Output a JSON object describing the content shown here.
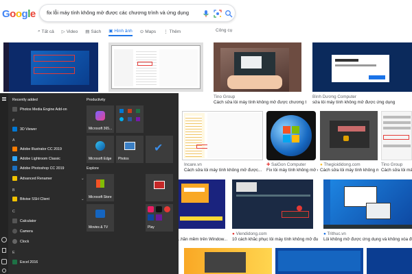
{
  "logo": "Google",
  "search": {
    "query": "fix lỗi máy tính không mở được các chương trình và ứng dụng"
  },
  "tabs": [
    {
      "label": "Tất cả",
      "icon": "search-icon",
      "active": false
    },
    {
      "label": "Video",
      "icon": "play-icon",
      "active": false
    },
    {
      "label": "Sách",
      "icon": "book-icon",
      "active": false
    },
    {
      "label": "Hình ảnh",
      "icon": "image-icon",
      "active": true
    },
    {
      "label": "Maps",
      "icon": "map-pin-icon",
      "active": false
    },
    {
      "label": "Thêm",
      "icon": "more-vert-icon",
      "active": false
    }
  ],
  "tools": "Công cụ",
  "results": [
    {
      "source": "",
      "title": ""
    },
    {
      "source": "",
      "title": ""
    },
    {
      "source": "Tino Group",
      "title": "Cách sửa lỗi máy tính không mở được chương tri..."
    },
    {
      "source": "Bình Dương Computer",
      "title": "sửa lỗi máy tính không mở được ứng dụng"
    },
    {
      "source": "Incare.vn",
      "title": "Cách sửa lỗi máy tính không mở được..."
    },
    {
      "source": "SaiGon Computer",
      "title": "Fix lỗi máy tính không mở được ứng dụng..."
    },
    {
      "source": "Thegioididong.com",
      "title": "Cách sửa lỗi máy tính không mở..."
    },
    {
      "source": "Tino Group",
      "title": "Cách sửa lỗi máy tí..."
    },
    {
      "source": "",
      "title": "...hần mềm trên Window..."
    },
    {
      "source": "Viendidong.com",
      "title": "10 cách khắc phục lỗi máy tính không mở được..."
    },
    {
      "source": "Trithuc.vn",
      "title": "Lỗi không mở được ứng dụng và không xóa được..."
    }
  ],
  "start_menu": {
    "recently_added": "Recently added",
    "apps": [
      {
        "label": "Photos Media Engine Add-on",
        "letter": ""
      },
      {
        "label": "3D Viewer",
        "letter": "#"
      },
      {
        "label": "Adobe Illustrator CC 2019",
        "letter": "A"
      },
      {
        "label": "Adobe Lightroom Classic",
        "letter": ""
      },
      {
        "label": "Adobe Photoshop CC 2019",
        "letter": ""
      },
      {
        "label": "Advanced Renamer",
        "letter": ""
      },
      {
        "label": "Bitvise SSH Client",
        "letter": "B"
      },
      {
        "label": "Calculator",
        "letter": "C"
      },
      {
        "label": "Camera",
        "letter": ""
      },
      {
        "label": "Clock",
        "letter": ""
      },
      {
        "label": "Excel 2016",
        "letter": "E"
      }
    ],
    "productivity": "Productivity",
    "explore": "Explore",
    "tiles": [
      {
        "label": "Microsoft 365..."
      },
      {
        "label": ""
      },
      {
        "label": "Microsoft Edge"
      },
      {
        "label": "Photos"
      },
      {
        "label": ""
      },
      {
        "label": "Microsoft Store"
      },
      {
        "label": ""
      },
      {
        "label": "Movies & TV"
      },
      {
        "label": "Play"
      }
    ]
  },
  "colors": {
    "accent": "#1a73e8",
    "start_bg": "#2b2b2b"
  }
}
